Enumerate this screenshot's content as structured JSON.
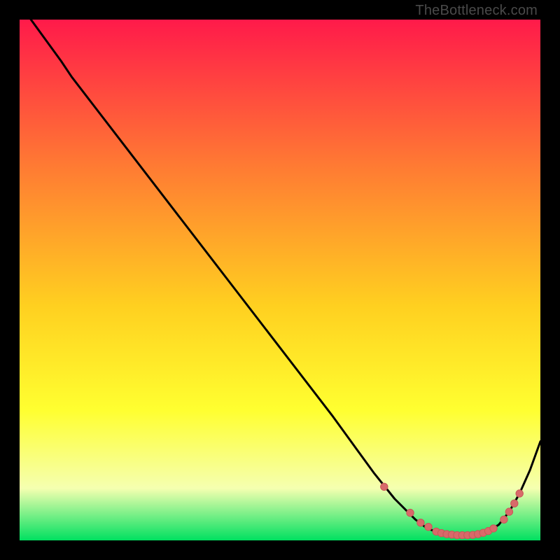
{
  "watermark": "TheBottleneck.com",
  "colors": {
    "gradient_top": "#ff1a4a",
    "gradient_mid1": "#ff7a33",
    "gradient_mid2": "#ffd020",
    "gradient_mid3": "#ffff30",
    "gradient_mid4": "#f5ffb0",
    "gradient_bottom": "#00e060",
    "curve": "#000000",
    "marker_fill": "#d86a6a",
    "marker_stroke": "#c85858"
  },
  "chart_data": {
    "type": "line",
    "title": "",
    "xlabel": "",
    "ylabel": "",
    "xlim": [
      0,
      100
    ],
    "ylim": [
      0,
      100
    ],
    "series": [
      {
        "name": "bottleneck-curve",
        "x": [
          0,
          8,
          10,
          20,
          30,
          40,
          50,
          60,
          68,
          72,
          76,
          78,
          80,
          82,
          84,
          86,
          88,
          90,
          92,
          94,
          96,
          98,
          100
        ],
        "y": [
          103,
          92,
          89,
          76,
          63,
          50,
          37,
          24,
          13,
          8,
          4,
          2.5,
          1.6,
          1.2,
          1.0,
          1.0,
          1.2,
          1.8,
          3.0,
          5.5,
          9.0,
          13.5,
          19
        ]
      }
    ],
    "markers": {
      "name": "highlight-points",
      "x": [
        70,
        75,
        77,
        78.5,
        80,
        81,
        82,
        83,
        84,
        85,
        86,
        87,
        88,
        89,
        90,
        91,
        93,
        94,
        95,
        96
      ],
      "y": [
        10.3,
        5.3,
        3.4,
        2.6,
        1.7,
        1.4,
        1.2,
        1.1,
        1.0,
        1.0,
        1.0,
        1.05,
        1.2,
        1.45,
        1.8,
        2.3,
        4.0,
        5.5,
        7.1,
        9.0
      ]
    }
  }
}
